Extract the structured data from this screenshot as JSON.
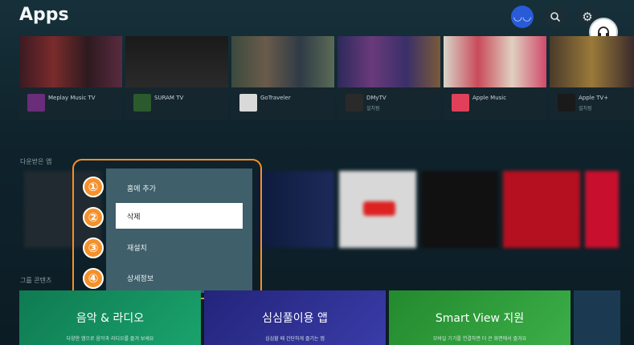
{
  "header": {
    "title": "Apps"
  },
  "icons": {
    "avatar": "avatar-icon",
    "search": "search-icon",
    "settings": "gear-icon",
    "support": "headset-icon"
  },
  "featured_apps": [
    {
      "name": "Meplay Music TV",
      "sub": ""
    },
    {
      "name": "SURAM TV",
      "sub": ""
    },
    {
      "name": "GoTraveler",
      "sub": ""
    },
    {
      "name": "DMyTV",
      "sub": "설치됨"
    },
    {
      "name": "Apple Music",
      "sub": ""
    },
    {
      "name": "Apple TV+",
      "sub": "설치됨"
    }
  ],
  "downloaded_label": "다운받은 앱",
  "group_label": "그룹 콘텐츠",
  "context_menu": {
    "items": [
      {
        "number": "①",
        "label": "홈에 추가"
      },
      {
        "number": "②",
        "label": "삭제"
      },
      {
        "number": "③",
        "label": "재설치"
      },
      {
        "number": "④",
        "label": "상세정보"
      }
    ],
    "selected_index": 1
  },
  "categories": [
    {
      "label": "음악 & 라디오",
      "caption": "다양한 앱으로 음악과 라디오를 즐겨 보세요"
    },
    {
      "label": "심심풀이용 앱",
      "caption": "심심할 때 간단하게 즐기는 앱"
    },
    {
      "label": "Smart View 지원",
      "caption": "모바일 기기를 연결하면 더 큰 화면에서 즐겨요"
    }
  ],
  "colors": {
    "accent": "#f5902a",
    "avatar": "#2a5bd7",
    "cat1": "#15905f",
    "cat2": "#2b2d8c",
    "cat3": "#2e9a3a"
  }
}
